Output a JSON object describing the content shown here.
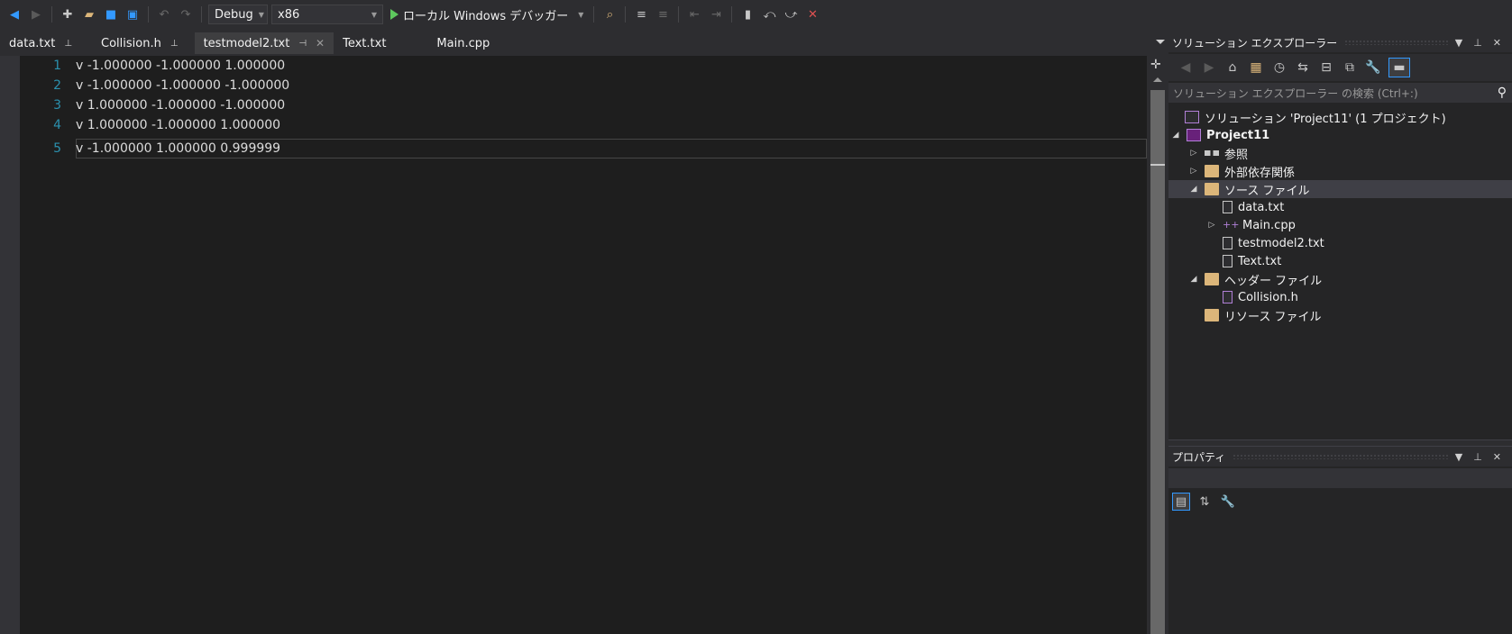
{
  "toolbar": {
    "config": "Debug",
    "platform": "x86",
    "run_label": "ローカル Windows デバッガー"
  },
  "tabs": [
    {
      "label": "data.txt",
      "pinned": true
    },
    {
      "label": "Collision.h",
      "pinned": true
    },
    {
      "label": "testmodel2.txt",
      "active": true
    },
    {
      "label": "Text.txt"
    },
    {
      "label": "Main.cpp"
    }
  ],
  "editor": {
    "lines": [
      {
        "num": "1",
        "text": "v -1.000000 -1.000000 1.000000"
      },
      {
        "num": "2",
        "text": "v -1.000000 -1.000000 -1.000000"
      },
      {
        "num": "3",
        "text": "v 1.000000 -1.000000 -1.000000"
      },
      {
        "num": "4",
        "text": "v 1.000000 -1.000000 1.000000"
      },
      {
        "num": "5",
        "text": "v -1.000000 1.000000 0.999999"
      }
    ],
    "current_line": "5"
  },
  "solution_explorer": {
    "title": "ソリューション エクスプローラー",
    "search_placeholder": "ソリューション エクスプローラー の検索 (Ctrl+:)",
    "tree": [
      {
        "label": "ソリューション 'Project11' (1 プロジェクト)",
        "icon": "solution-icon"
      },
      {
        "label": "Project11",
        "icon": "project-icon",
        "expander": "expanded"
      },
      {
        "label": "参照",
        "icon": "references-icon",
        "expander": "collapsed"
      },
      {
        "label": "外部依存関係",
        "icon": "folder-icon",
        "expander": "collapsed"
      },
      {
        "label": "ソース ファイル",
        "icon": "folder-icon",
        "expander": "expanded",
        "selected": true
      },
      {
        "label": "data.txt",
        "icon": "text-file-icon"
      },
      {
        "label": "Main.cpp",
        "icon": "cpp-file-icon",
        "expander": "collapsed"
      },
      {
        "label": "testmodel2.txt",
        "icon": "text-file-icon"
      },
      {
        "label": "Text.txt",
        "icon": "text-file-icon"
      },
      {
        "label": "ヘッダー ファイル",
        "icon": "folder-icon",
        "expander": "expanded"
      },
      {
        "label": "Collision.h",
        "icon": "header-file-icon"
      },
      {
        "label": "リソース ファイル",
        "icon": "folder-icon"
      }
    ]
  },
  "properties": {
    "title": "プロパティ"
  },
  "colors": {
    "line_number": "#2b91af",
    "editor_bg": "#1e1e1e",
    "accent": "#3399ff"
  }
}
